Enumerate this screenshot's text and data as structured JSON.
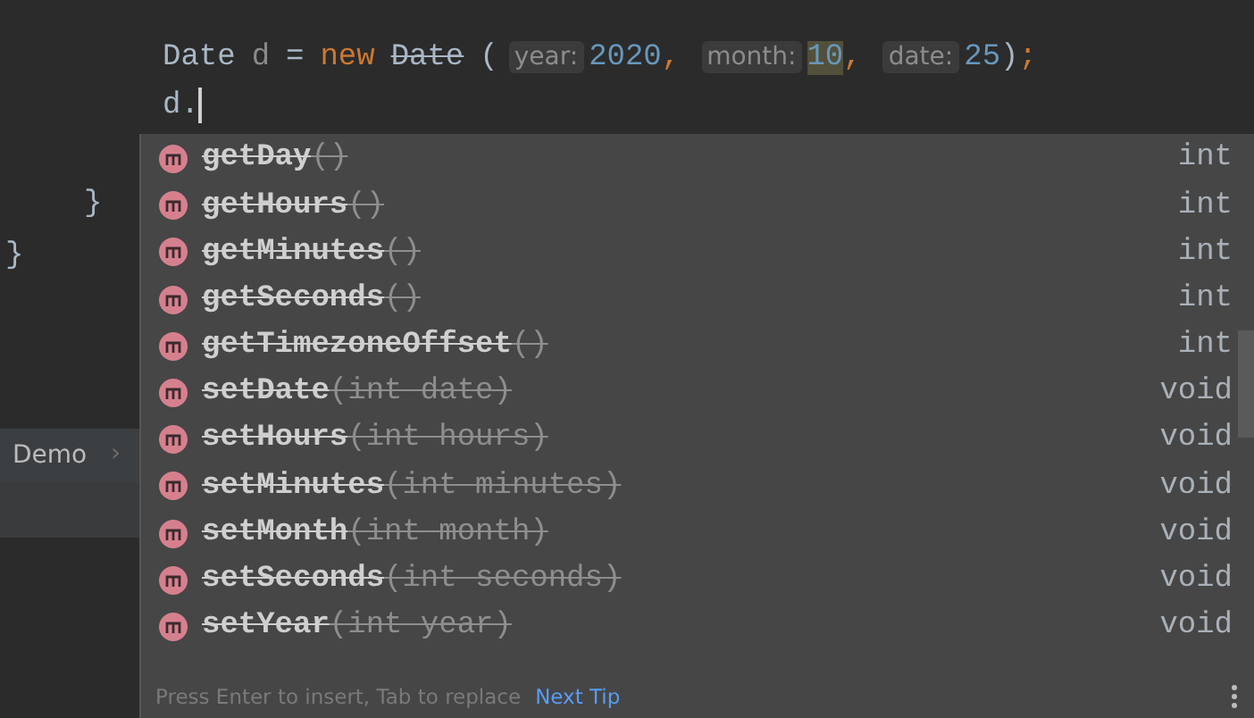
{
  "editor": {
    "lines": [
      {
        "kind": "code",
        "tokens": [
          {
            "kind": "type",
            "text": "Date"
          },
          {
            "kind": "var",
            "text": "d"
          },
          {
            "kind": "op",
            "text": "="
          },
          {
            "kind": "keyword",
            "text": "new"
          },
          {
            "kind": "deprecated",
            "text": "Date"
          },
          {
            "kind": "punct",
            "text": "("
          },
          {
            "kind": "hint",
            "text": "year:"
          },
          {
            "kind": "number",
            "text": "2020"
          },
          {
            "kind": "comma",
            "text": ","
          },
          {
            "kind": "hint",
            "text": "month:"
          },
          {
            "kind": "number",
            "text": "10",
            "highlighted": true
          },
          {
            "kind": "comma",
            "text": ","
          },
          {
            "kind": "hint",
            "text": "date:"
          },
          {
            "kind": "number",
            "text": "25"
          },
          {
            "kind": "punct",
            "text": ")"
          },
          {
            "kind": "comma",
            "text": ";"
          }
        ]
      },
      {
        "kind": "code",
        "tokens": [
          {
            "kind": "type",
            "text": "d."
          }
        ],
        "caret": true
      },
      {
        "kind": "blank"
      },
      {
        "kind": "inner_brace",
        "tokens": [
          {
            "kind": "type",
            "text": "}"
          }
        ]
      },
      {
        "kind": "outer_brace",
        "tokens": [
          {
            "kind": "type",
            "text": "}"
          }
        ]
      }
    ]
  },
  "breadcrumb": {
    "label": "Demo",
    "chevron": "›"
  },
  "completion": {
    "items": [
      {
        "name": "getDay",
        "params": "()",
        "type": "int",
        "deprecated": true
      },
      {
        "name": "getHours",
        "params": "()",
        "type": "int",
        "deprecated": true
      },
      {
        "name": "getMinutes",
        "params": "()",
        "type": "int",
        "deprecated": true
      },
      {
        "name": "getSeconds",
        "params": "()",
        "type": "int",
        "deprecated": true
      },
      {
        "name": "getTimezoneOffset",
        "params": "()",
        "type": "int",
        "deprecated": true
      },
      {
        "name": "setDate",
        "params": "(int date)",
        "type": "void",
        "deprecated": true
      },
      {
        "name": "setHours",
        "params": "(int hours)",
        "type": "void",
        "deprecated": true
      },
      {
        "name": "setMinutes",
        "params": "(int minutes)",
        "type": "void",
        "deprecated": true
      },
      {
        "name": "setMonth",
        "params": "(int month)",
        "type": "void",
        "deprecated": true
      },
      {
        "name": "setSeconds",
        "params": "(int seconds)",
        "type": "void",
        "deprecated": true
      },
      {
        "name": "setYear",
        "params": "(int year)",
        "type": "void",
        "deprecated": true
      }
    ],
    "footer": {
      "text": "Press Enter to insert, Tab to replace",
      "link": "Next Tip"
    }
  }
}
